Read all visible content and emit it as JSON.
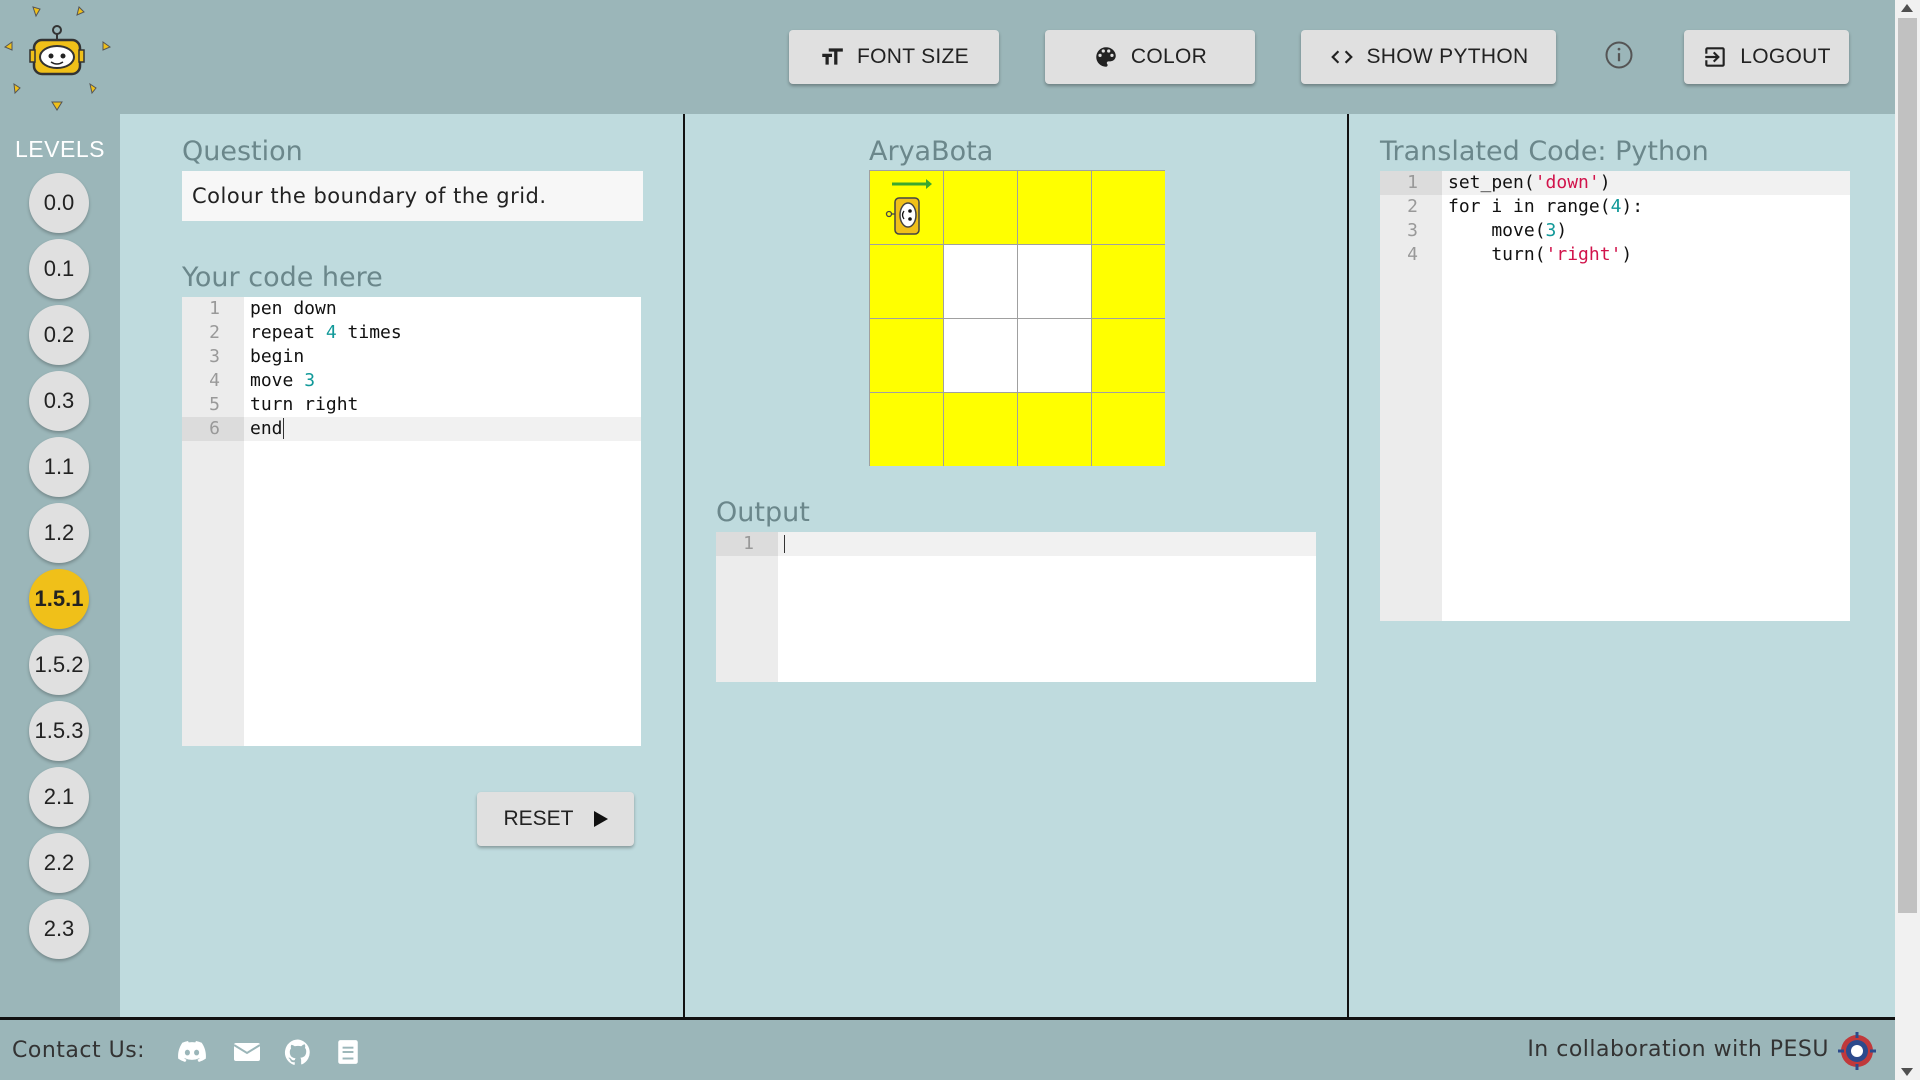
{
  "header": {
    "font_size_label": "FONT SIZE",
    "color_label": "COLOR",
    "show_python_label": "SHOW PYTHON",
    "logout_label": "LOGOUT"
  },
  "levels": {
    "title": "LEVELS",
    "items": [
      "0.0",
      "0.1",
      "0.2",
      "0.3",
      "1.1",
      "1.2",
      "1.5.1",
      "1.5.2",
      "1.5.3",
      "2.1",
      "2.2",
      "2.3"
    ],
    "active": "1.5.1"
  },
  "question": {
    "title": "Question",
    "text": "Colour the boundary of the grid."
  },
  "code_editor": {
    "title": "Your code here",
    "line_numbers": [
      "1",
      "2",
      "3",
      "4",
      "5",
      "6"
    ]
  },
  "reset_label": "RESET",
  "board": {
    "title": "AryaBota",
    "rows": 4,
    "cols": 4,
    "colored_cells": "boundary",
    "robot_cell": [
      0,
      0
    ],
    "robot_direction": "right",
    "colors": {
      "filled": "#ffff00",
      "empty": "#ffffff",
      "arrow": "#3aa82f"
    }
  },
  "output": {
    "title": "Output",
    "line_numbers": [
      "1"
    ],
    "content": ""
  },
  "python": {
    "title": "Translated Code: Python",
    "line_numbers": [
      "1",
      "2",
      "3",
      "4"
    ]
  },
  "footer": {
    "contact_label": "Contact Us:",
    "collab_label": "In collaboration with PESU"
  },
  "colors": {
    "header_bg": "#9bb6b9",
    "page_bg": "#bfdbde",
    "active_level": "#f0c019"
  }
}
